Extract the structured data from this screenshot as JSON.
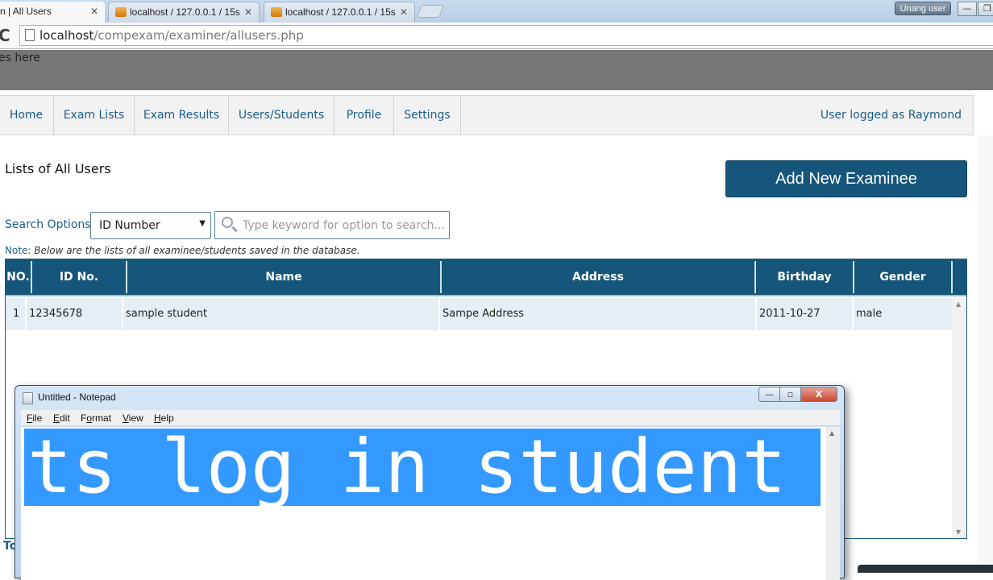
{
  "browser": {
    "tabs": [
      {
        "label": "n | All Users",
        "active": true
      },
      {
        "label": "localhost / 127.0.0.1 / 15s",
        "active": false,
        "icon": "pma-icon"
      },
      {
        "label": "localhost / 127.0.0.1 / 15s",
        "active": false,
        "icon": "pma-icon"
      }
    ],
    "tab_close": "✕",
    "profile_badge": "Unang user",
    "window_buttons": {
      "minimize": "—",
      "restore": "❐"
    },
    "url_host": "localhost",
    "url_path": "/compexam/examiner/allusers.php",
    "reload_glyph": "C"
  },
  "site": {
    "header_text": "es here",
    "nav": {
      "items": [
        "Home",
        "Exam Lists",
        "Exam Results",
        "Users/Students",
        "Profile",
        "Settings"
      ],
      "user_status": "User logged as Raymond"
    },
    "page_title": "Lists of All Users",
    "add_button": "Add New Examinee",
    "search": {
      "label": "Search Options:",
      "selected_option": "ID Number",
      "caret": "▼",
      "placeholder": "Type keyword for option to search..."
    },
    "note": {
      "label": "Note:",
      "text": "Below are the lists of all examinee/students saved in the database."
    },
    "table": {
      "headers": [
        "NO.",
        "ID No.",
        "Name",
        "Address",
        "Birthday",
        "Gender"
      ],
      "rows": [
        {
          "no": "1",
          "id": "12345678",
          "name": "sample student",
          "address": "Sampe Address",
          "birthday": "2011-10-27",
          "gender": "male"
        }
      ],
      "scroll_up": "▲",
      "scroll_down": "▼"
    },
    "footer_text": "To"
  },
  "notepad": {
    "title": "Untitled - Notepad",
    "menu": [
      {
        "accel": "F",
        "rest": "ile"
      },
      {
        "accel": "E",
        "rest": "dit"
      },
      {
        "pre": "F",
        "accel": "o",
        "rest": "rmat"
      },
      {
        "accel": "V",
        "rest": "iew"
      },
      {
        "accel": "H",
        "rest": "elp"
      }
    ],
    "selected_text": "ts log in student",
    "buttons": {
      "minimize": "—",
      "maximize": "▫",
      "close": "X"
    },
    "scroll_up": "▲"
  }
}
